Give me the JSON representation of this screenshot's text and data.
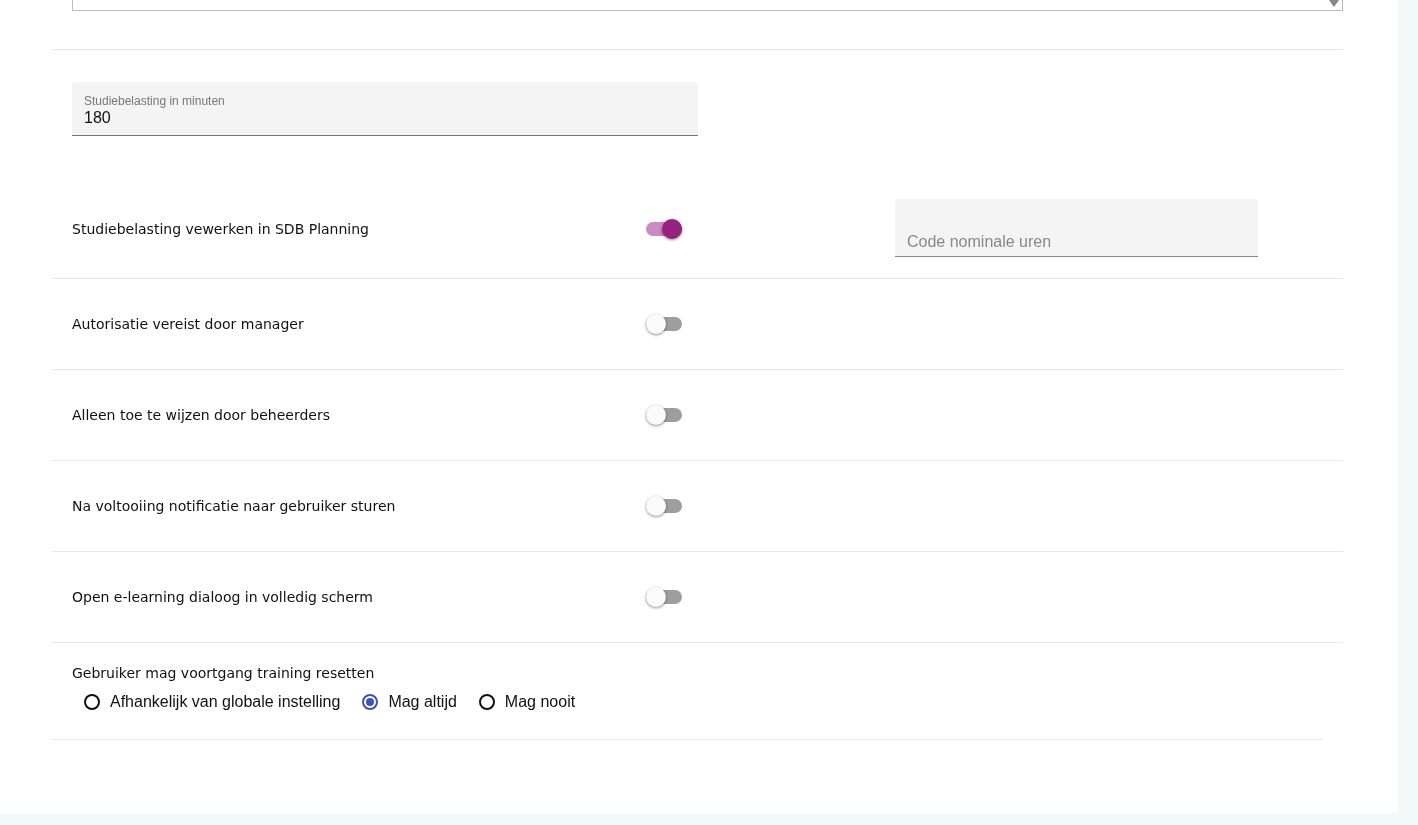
{
  "study_load_field": {
    "label": "Studiebelasting in minuten",
    "value": "180"
  },
  "settings": [
    {
      "label": "Studiebelasting vewerken in SDB Planning",
      "on": true,
      "extra_field": {
        "placeholder": "Code nominale uren"
      }
    },
    {
      "label": "Autorisatie vereist door manager",
      "on": false
    },
    {
      "label": "Alleen toe te wijzen door beheerders",
      "on": false
    },
    {
      "label": "Na voltooiing notificatie naar gebruiker sturen",
      "on": false
    },
    {
      "label": "Open e-learning dialoog in volledig scherm",
      "on": false
    }
  ],
  "reset_option": {
    "label": "Gebruiker mag voortgang training resetten",
    "options": [
      {
        "label": "Afhankelijk van globale instelling",
        "selected": false
      },
      {
        "label": "Mag altijd",
        "selected": true
      },
      {
        "label": "Mag nooit",
        "selected": false
      }
    ]
  }
}
